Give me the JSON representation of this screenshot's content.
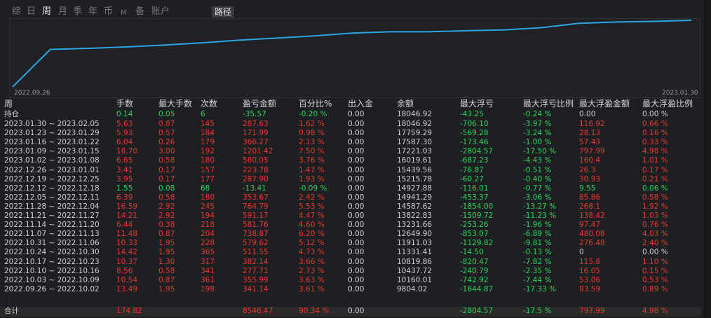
{
  "toolbar": {
    "tabs": [
      {
        "label": "综",
        "active": false
      },
      {
        "label": "日",
        "active": false
      },
      {
        "label": "周",
        "active": true
      },
      {
        "label": "月",
        "active": false
      },
      {
        "label": "季",
        "active": false
      },
      {
        "label": "年",
        "active": false
      },
      {
        "label": "币",
        "active": false
      },
      {
        "label": "M",
        "active": false
      },
      {
        "label": "备",
        "active": false
      },
      {
        "label": "账户",
        "active": false
      }
    ],
    "route_label": "路径"
  },
  "chart": {
    "x_start": "2022.09.26",
    "x_end": "2023.01.30",
    "line_color": "#2aa6e6"
  },
  "chart_data": {
    "type": "line",
    "xlabel": "",
    "ylabel": "",
    "x": [
      "2022.09.26",
      "2022.10.03",
      "2022.10.10",
      "2022.10.17",
      "2022.10.24",
      "2022.10.31",
      "2022.11.07",
      "2022.11.14",
      "2022.11.21",
      "2022.11.28",
      "2022.12.05",
      "2022.12.12",
      "2022.12.19",
      "2022.12.26",
      "2023.01.02",
      "2023.01.09",
      "2023.01.16",
      "2023.01.23",
      "2023.01.30"
    ],
    "series": [
      {
        "values": [
          0,
          10160.01,
          10437.72,
          10819.86,
          11331.41,
          11911.03,
          12649.9,
          13231.66,
          13822.83,
          14587.62,
          14941.29,
          14927.88,
          15215.78,
          15439.56,
          16019.61,
          17221.03,
          17587.3,
          17759.29,
          18046.92
        ]
      }
    ]
  },
  "table": {
    "headers": [
      "周",
      "手数",
      "最大手数",
      "次数",
      "盈亏金额",
      "百分比%",
      "出入金",
      "余额",
      "最大浮亏",
      "最大浮亏比例",
      "最大浮盈金额",
      "最大浮盈比例"
    ],
    "position_row": {
      "label": "持仓",
      "cells": [
        "0.14",
        "0.05",
        "6",
        "-35.57",
        "-0.20 %",
        "0.00",
        "18046.92",
        "-43.25",
        "-0.24 %",
        "0.00",
        "0.00 %"
      ],
      "colors": [
        "green",
        "green",
        "green",
        "green",
        "green",
        "white",
        "white",
        "green",
        "green",
        "white",
        "white"
      ]
    },
    "rows": [
      {
        "label": "2023.01.30 ~ 2023.02.05",
        "cells": [
          "5.63",
          "0.87",
          "145",
          "287.63",
          "1.62 %",
          "0.00",
          "18046.92",
          "-706.10",
          "-3.97 %",
          "116.92",
          "0.66 %"
        ],
        "color": "red"
      },
      {
        "label": "2023.01.23 ~ 2023.01.29",
        "cells": [
          "5.93",
          "0.57",
          "184",
          "171.99",
          "0.98 %",
          "0.00",
          "17759.29",
          "-569.28",
          "-3.24 %",
          "28.13",
          "0.16 %"
        ],
        "color": "red"
      },
      {
        "label": "2023.01.16 ~ 2023.01.22",
        "cells": [
          "6.04",
          "0.26",
          "179",
          "366.27",
          "2.13 %",
          "0.00",
          "17587.30",
          "-173.46",
          "-1.00 %",
          "57.43",
          "0.33 %"
        ],
        "color": "red"
      },
      {
        "label": "2023.01.09 ~ 2023.01.15",
        "cells": [
          "18.70",
          "3.00",
          "192",
          "1201.42",
          "7.50 %",
          "0.00",
          "17221.03",
          "-2804.57",
          "-17.50 %",
          "797.99",
          "4.98 %"
        ],
        "color": "red"
      },
      {
        "label": "2023.01.02 ~ 2023.01.08",
        "cells": [
          "6.65",
          "0.58",
          "180",
          "580.05",
          "3.76 %",
          "0.00",
          "16019.61",
          "-687.23",
          "-4.43 %",
          "160.4",
          "1.01 %"
        ],
        "color": "red"
      },
      {
        "label": "2022.12.26 ~ 2023.01.01",
        "cells": [
          "3.41",
          "0.17",
          "157",
          "223.78",
          "1.47 %",
          "0.00",
          "15439.56",
          "-76.87",
          "-0.51 %",
          "26.3",
          "0.17 %"
        ],
        "color": "red"
      },
      {
        "label": "2022.12.19 ~ 2022.12.25",
        "cells": [
          "3.95",
          "0.17",
          "177",
          "287.90",
          "1.93 %",
          "0.00",
          "15215.78",
          "-60.27",
          "-0.40 %",
          "30.93",
          "0.21 %"
        ],
        "color": "red"
      },
      {
        "label": "2022.12.12 ~ 2022.12.18",
        "cells": [
          "1.55",
          "0.08",
          "68",
          "-13.41",
          "-0.09 %",
          "0.00",
          "14927.88",
          "-116.01",
          "-0.77 %",
          "9.55",
          "0.06 %"
        ],
        "color": "green"
      },
      {
        "label": "2022.12.05 ~ 2022.12.11",
        "cells": [
          "6.39",
          "0.58",
          "180",
          "353.67",
          "2.42 %",
          "0.00",
          "14941.29",
          "-453.37",
          "-3.06 %",
          "85.86",
          "0.58 %"
        ],
        "color": "red"
      },
      {
        "label": "2022.11.28 ~ 2022.12.04",
        "cells": [
          "16.59",
          "2.92",
          "245",
          "764.79",
          "5.53 %",
          "0.00",
          "14587.62",
          "-1854.00",
          "-13.27 %",
          "268.1",
          "1.92 %"
        ],
        "color": "red"
      },
      {
        "label": "2022.11.21 ~ 2022.11.27",
        "cells": [
          "14.21",
          "2.92",
          "194",
          "591.17",
          "4.47 %",
          "0.00",
          "13822.83",
          "-1509.72",
          "-11.23 %",
          "138.42",
          "1.03 %"
        ],
        "color": "red"
      },
      {
        "label": "2022.11.14 ~ 2022.11.20",
        "cells": [
          "6.44",
          "0.38",
          "218",
          "581.76",
          "4.60 %",
          "0.00",
          "13231.66",
          "-253.26",
          "-1.96 %",
          "97.47",
          "0.76 %"
        ],
        "color": "red"
      },
      {
        "label": "2022.11.07 ~ 2022.11.13",
        "cells": [
          "11.48",
          "0.87",
          "204",
          "738.87",
          "6.20 %",
          "0.00",
          "12649.90",
          "-853.07",
          "-6.89 %",
          "480.08",
          "4.03 %"
        ],
        "color": "red"
      },
      {
        "label": "2022.10.31 ~ 2022.11.06",
        "cells": [
          "10.33",
          "1.95",
          "228",
          "579.62",
          "5.12 %",
          "0.00",
          "11911.03",
          "-1129.82",
          "-9.81 %",
          "276.48",
          "2.40 %"
        ],
        "color": "red"
      },
      {
        "label": "2022.10.24 ~ 2022.10.30",
        "cells": [
          "14.42",
          "1.95",
          "365",
          "511.55",
          "4.73 %",
          "0.00",
          "11331.41",
          "-14.50",
          "-0.13 %",
          "0",
          "0.00 %"
        ],
        "color": "red"
      },
      {
        "label": "2022.10.17 ~ 2022.10.23",
        "cells": [
          "10.37",
          "1.30",
          "317",
          "382.14",
          "3.66 %",
          "0.00",
          "10819.86",
          "-820.47",
          "-7.82 %",
          "115.8",
          "1.10 %"
        ],
        "color": "red"
      },
      {
        "label": "2022.10.10 ~ 2022.10.16",
        "cells": [
          "8.56",
          "0.58",
          "341",
          "277.71",
          "2.73 %",
          "0.00",
          "10437.72",
          "-240.79",
          "-2.35 %",
          "16.05",
          "0.15 %"
        ],
        "color": "red"
      },
      {
        "label": "2022.10.03 ~ 2022.10.09",
        "cells": [
          "10.54",
          "0.87",
          "361",
          "355.99",
          "3.63 %",
          "0.00",
          "10160.01",
          "-742.92",
          "-7.44 %",
          "53.06",
          "0.53 %"
        ],
        "color": "red"
      },
      {
        "label": "2022.09.26 ~ 2022.10.02",
        "cells": [
          "13.49",
          "1.95",
          "198",
          "341.14",
          "3.61 %",
          "0.00",
          "9804.02",
          "-1644.87",
          "-17.33 %",
          "83.59",
          "0.89 %"
        ],
        "color": "red"
      }
    ],
    "total_row": {
      "label": "合计",
      "cells": [
        "174.82",
        "",
        "",
        "8546.47",
        "90.34 %",
        "0.00",
        "",
        "-2804.57",
        "-17.5 %",
        "797.99",
        "4.98 %"
      ]
    }
  }
}
